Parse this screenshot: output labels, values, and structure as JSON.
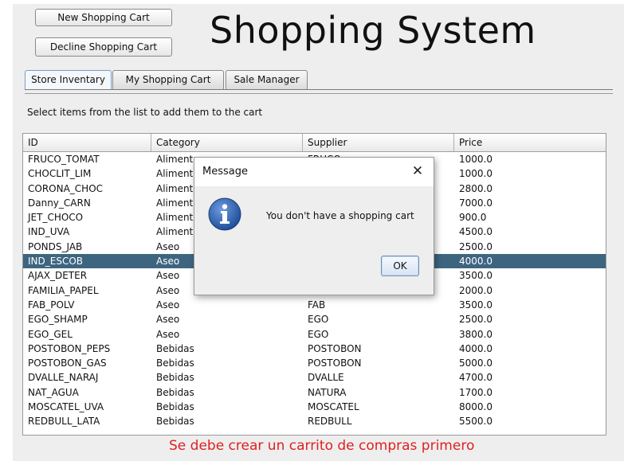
{
  "app": {
    "title": "Shopping System",
    "buttons": {
      "new_cart": "New Shopping Cart",
      "decline_cart": "Decline Shopping Cart"
    }
  },
  "tabs": [
    {
      "label": "Store Inventary",
      "active": true
    },
    {
      "label": "My Shopping Cart",
      "active": false
    },
    {
      "label": "Sale Manager",
      "active": false
    }
  ],
  "inventory": {
    "instruction": "Select items from the list to add them to the cart",
    "columns": [
      "ID",
      "Category",
      "Supplier",
      "Price"
    ],
    "rows": [
      [
        "FRUCO_TOMAT",
        "Aliment",
        "FRUCO",
        "1000.0"
      ],
      [
        "CHOCLIT_LIM",
        "Aliment",
        "",
        "1000.0"
      ],
      [
        "CORONA_CHOC",
        "Aliment",
        "",
        "2800.0"
      ],
      [
        "Danny_CARN",
        "Aliment",
        "",
        "7000.0"
      ],
      [
        "JET_CHOCO",
        "Aliment",
        "",
        "900.0"
      ],
      [
        "IND_UVA",
        "Aliment",
        "",
        "4500.0"
      ],
      [
        "PONDS_JAB",
        "Aseo",
        "",
        "2500.0"
      ],
      [
        "IND_ESCOB",
        "Aseo",
        "",
        "4000.0"
      ],
      [
        "AJAX_DETER",
        "Aseo",
        "",
        "3500.0"
      ],
      [
        "FAMILIA_PAPEL",
        "Aseo",
        "FAMILIA",
        "2000.0"
      ],
      [
        "FAB_POLV",
        "Aseo",
        "FAB",
        "3500.0"
      ],
      [
        "EGO_SHAMP",
        "Aseo",
        "EGO",
        "2500.0"
      ],
      [
        "EGO_GEL",
        "Aseo",
        "EGO",
        "3800.0"
      ],
      [
        "POSTOBON_PEPS",
        "Bebidas",
        "POSTOBON",
        "4000.0"
      ],
      [
        "POSTOBON_GAS",
        "Bebidas",
        "POSTOBON",
        "5000.0"
      ],
      [
        "DVALLE_NARAJ",
        "Bebidas",
        "DVALLE",
        "4700.0"
      ],
      [
        "NAT_AGUA",
        "Bebidas",
        "NATURA",
        "1700.0"
      ],
      [
        "MOSCATEL_UVA",
        "Bebidas",
        "MOSCATEL",
        "8000.0"
      ],
      [
        "REDBULL_LATA",
        "Bebidas",
        "REDBULL",
        "5500.0"
      ]
    ],
    "selected_row": 7
  },
  "status_message": "Se debe crear un carrito de compras primero",
  "dialog": {
    "title": "Message",
    "message": "You don't have a shopping cart",
    "ok_label": "OK",
    "icon": "info-icon"
  },
  "colors": {
    "selection": "#3e6580",
    "error_text": "#e02020",
    "info_icon": "#2f5fa8"
  }
}
